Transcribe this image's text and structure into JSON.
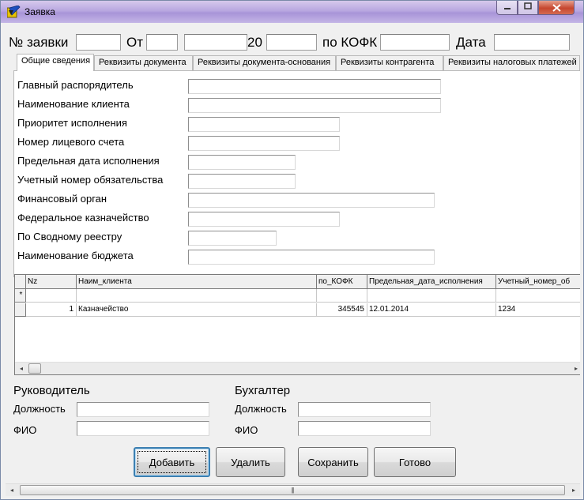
{
  "window": {
    "title": "Заявка"
  },
  "header": {
    "number_label": "№ заявки",
    "from_label": "От",
    "year_label": "20",
    "kofk_label": "по КОФК",
    "date_label": "Дата"
  },
  "tabs": [
    {
      "label": "Общие сведения"
    },
    {
      "label": "Реквизиты документа"
    },
    {
      "label": "Реквизиты документа-основания"
    },
    {
      "label": "Реквизиты контрагента"
    },
    {
      "label": "Реквизиты налоговых платежей"
    }
  ],
  "form": {
    "fields": [
      {
        "label": "Главный распорядитель",
        "value": ""
      },
      {
        "label": "Наименование клиента",
        "value": ""
      },
      {
        "label": "Приоритет исполнения",
        "value": ""
      },
      {
        "label": "Номер лицевого счета",
        "value": ""
      },
      {
        "label": "Предельная дата исполнения",
        "value": ""
      },
      {
        "label": "Учетный номер обязательства",
        "value": ""
      },
      {
        "label": "Финансовый орган",
        "value": ""
      },
      {
        "label": "Федеральное казначейство",
        "value": ""
      },
      {
        "label": "По Сводному реестру",
        "value": ""
      },
      {
        "label": "Наименование бюджета",
        "value": ""
      }
    ]
  },
  "grid": {
    "columns": [
      "Nz",
      "Наим_клиента",
      "по_КОФК",
      "Предельная_дата_исполнения",
      "Учетный_номер_об"
    ],
    "new_row_marker": "*",
    "rows": [
      [
        "1",
        "Казначейство",
        "345545",
        "12.01.2014",
        "1234"
      ]
    ]
  },
  "signatures": {
    "head": {
      "title": "Руководитель",
      "position_label": "Должность",
      "name_label": "ФИО"
    },
    "accountant": {
      "title": "Бухгалтер",
      "position_label": "Должность",
      "name_label": "ФИО"
    }
  },
  "buttons": {
    "add": "Добавить",
    "delete": "Удалить",
    "save": "Сохранить",
    "done": "Готово"
  },
  "icons": {
    "app": "app-icon",
    "minimize": "minimize-icon",
    "maximize": "maximize-icon",
    "close": "close-icon"
  },
  "colors": {
    "titlebar": "#b8a7e0",
    "close_button": "#c6472e",
    "default_button_border": "#3c7fb1"
  }
}
